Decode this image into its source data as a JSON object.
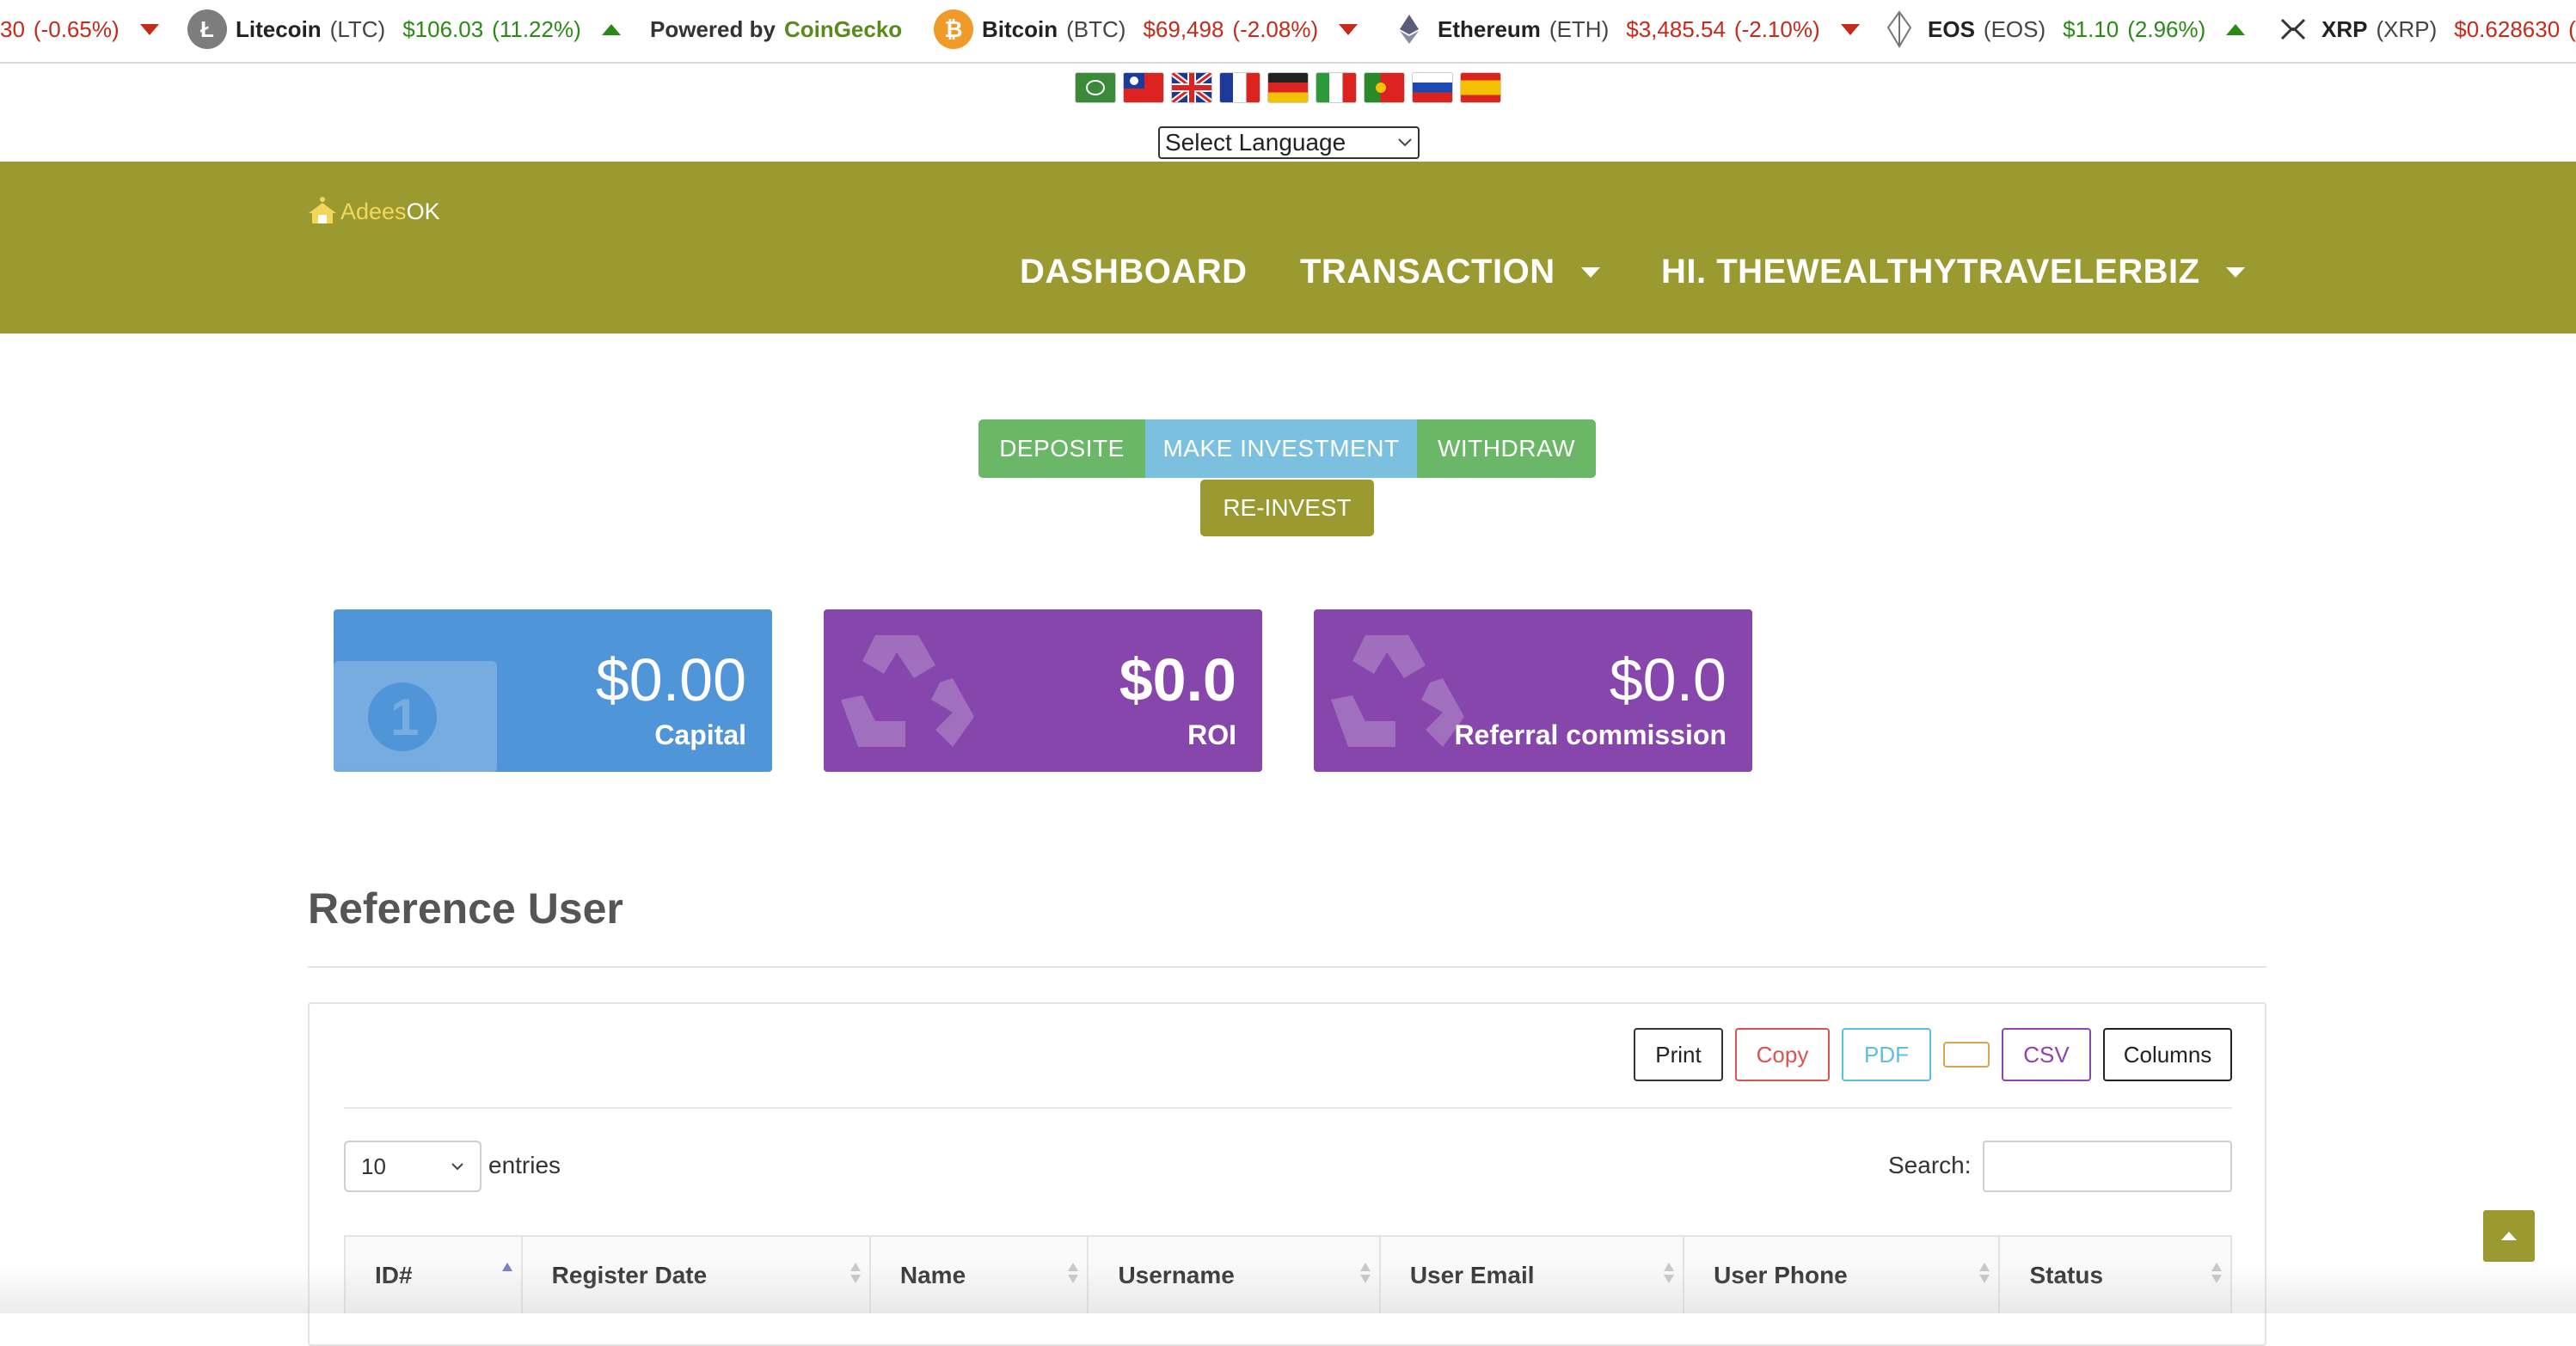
{
  "ticker": {
    "items": [
      {
        "icon": "",
        "name": "",
        "symbol": "",
        "price": "30",
        "change": "(-0.65%)",
        "dir": "down"
      },
      {
        "icon": "litecoin-icon",
        "name": "Litecoin",
        "symbol": "(LTC)",
        "price": "$106.03",
        "change": "(11.22%)",
        "dir": "up"
      },
      {
        "icon": "bitcoin-icon",
        "name": "Bitcoin",
        "symbol": "(BTC)",
        "price": "$69,498",
        "change": "(-2.08%)",
        "dir": "down"
      },
      {
        "icon": "ethereum-icon",
        "name": "Ethereum",
        "symbol": "(ETH)",
        "price": "$3,485.54",
        "change": "(-2.10%)",
        "dir": "down"
      },
      {
        "icon": "eos-icon",
        "name": "EOS",
        "symbol": "(EOS)",
        "price": "$1.10",
        "change": "(2.96%)",
        "dir": "up"
      },
      {
        "icon": "xrp-icon",
        "name": "XRP",
        "symbol": "(XRP)",
        "price": "$0.628630",
        "change": "(-",
        "dir": "down"
      }
    ],
    "powered_by": "Powered by",
    "powered_brand": "CoinGecko"
  },
  "language": {
    "flags": [
      "arabic-flag-icon",
      "taiwan-flag-icon",
      "uk-flag-icon",
      "france-flag-icon",
      "germany-flag-icon",
      "italy-flag-icon",
      "portugal-flag-icon",
      "russia-flag-icon",
      "spain-flag-icon"
    ],
    "select_label": "Select Language"
  },
  "header": {
    "logo_part1": "Adees",
    "logo_part2": "OK",
    "nav": {
      "dashboard": "DASHBOARD",
      "transaction": "TRANSACTION",
      "user": "HI. THEWEALTHYTRAVELERBIZ"
    }
  },
  "actions": {
    "deposite": "DEPOSITE",
    "make_investment": "MAKE INVESTMENT",
    "withdraw": "WITHDRAW",
    "reinvest": "RE-INVEST"
  },
  "cards": {
    "capital": {
      "value": "$0.00",
      "label": "Capital"
    },
    "roi": {
      "value": "$0.0",
      "label": "ROI"
    },
    "referral": {
      "value": "$0.0",
      "label": "Referral commission"
    }
  },
  "reference": {
    "title": "Reference User",
    "toolbar": {
      "print": "Print",
      "copy": "Copy",
      "pdf": "PDF",
      "excel": "",
      "csv": "CSV",
      "columns": "Columns"
    },
    "entries_value": "10",
    "entries_label": "entries",
    "search_label": "Search:",
    "columns": [
      "ID#",
      "Register Date",
      "Name",
      "Username",
      "User Email",
      "User Phone",
      "Status"
    ]
  },
  "colors": {
    "brand_olive": "#9a9a30",
    "deposit_green": "#6ab867",
    "invest_blue": "#7cc0e0",
    "capital_blue": "#4f95d8",
    "purple": "#8646ab"
  }
}
